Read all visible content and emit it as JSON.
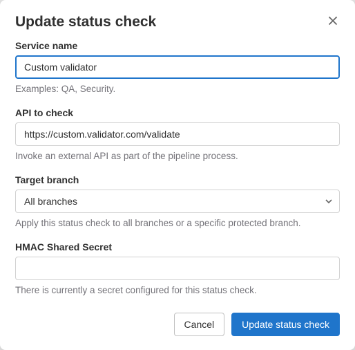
{
  "modal": {
    "title": "Update status check",
    "fields": {
      "service_name": {
        "label": "Service name",
        "value": "Custom validator",
        "help": "Examples: QA, Security."
      },
      "api": {
        "label": "API to check",
        "value": "https://custom.validator.com/validate",
        "help": "Invoke an external API as part of the pipeline process."
      },
      "target_branch": {
        "label": "Target branch",
        "value": "All branches",
        "help": "Apply this status check to all branches or a specific protected branch."
      },
      "hmac": {
        "label": "HMAC Shared Secret",
        "value": "",
        "help": "There is currently a secret configured for this status check."
      }
    },
    "buttons": {
      "cancel": "Cancel",
      "submit": "Update status check"
    }
  }
}
